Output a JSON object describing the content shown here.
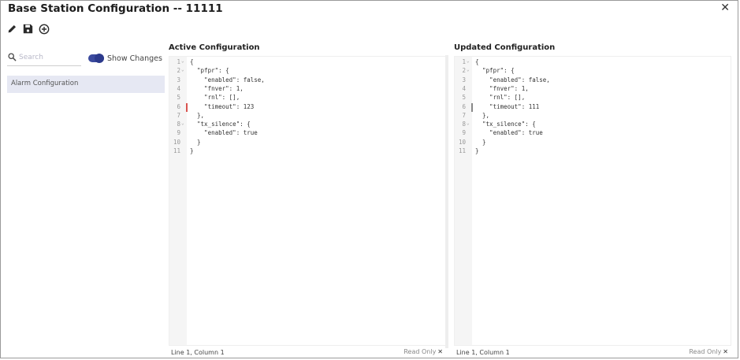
{
  "window": {
    "title": "Base Station Configuration -- 11111",
    "close_glyph": "✕"
  },
  "toolbar": {
    "icons": [
      "pencil-icon",
      "save-icon",
      "plus-circle-icon"
    ]
  },
  "sidebar": {
    "search_placeholder": "Search",
    "show_changes_label": "Show Changes",
    "show_changes_on": true,
    "items": [
      {
        "label": "Alarm Configuration"
      }
    ]
  },
  "panes": {
    "active": {
      "title": "Active Configuration",
      "lines": [
        {
          "n": "1",
          "fold": "⌄",
          "code": "{"
        },
        {
          "n": "2",
          "fold": "⌄",
          "code": "  \"pfpr\": {"
        },
        {
          "n": "3",
          "fold": "",
          "code": "    \"enabled\": false,"
        },
        {
          "n": "4",
          "fold": "",
          "code": "    \"fnver\": 1,"
        },
        {
          "n": "5",
          "fold": "",
          "code": "    \"rnl\": [],"
        },
        {
          "n": "6",
          "fold": "",
          "code": "    \"timeout\": 123"
        },
        {
          "n": "7",
          "fold": "",
          "code": "  },"
        },
        {
          "n": "8",
          "fold": "⌄",
          "code": "  \"tx_silence\": {"
        },
        {
          "n": "9",
          "fold": "",
          "code": "    \"enabled\": true"
        },
        {
          "n": "10",
          "fold": "",
          "code": "  }"
        },
        {
          "n": "11",
          "fold": "",
          "code": "}"
        }
      ],
      "status_position": "Line 1, Column 1",
      "status_mode": "Read Only"
    },
    "updated": {
      "title": "Updated Configuration",
      "lines": [
        {
          "n": "1",
          "fold": "⌄",
          "code": "{"
        },
        {
          "n": "2",
          "fold": "⌄",
          "code": "  \"pfpr\": {"
        },
        {
          "n": "3",
          "fold": "",
          "code": "    \"enabled\": false,"
        },
        {
          "n": "4",
          "fold": "",
          "code": "    \"fnver\": 1,"
        },
        {
          "n": "5",
          "fold": "",
          "code": "    \"rnl\": [],"
        },
        {
          "n": "6",
          "fold": "",
          "code": "    \"timeout\": 111"
        },
        {
          "n": "7",
          "fold": "",
          "code": "  },"
        },
        {
          "n": "8",
          "fold": "⌄",
          "code": "  \"tx_silence\": {"
        },
        {
          "n": "9",
          "fold": "",
          "code": "    \"enabled\": true"
        },
        {
          "n": "10",
          "fold": "",
          "code": "  }"
        },
        {
          "n": "11",
          "fold": "",
          "code": "}"
        }
      ],
      "status_position": "Line 1, Column 1",
      "status_mode": "Read Only"
    }
  },
  "colors": {
    "accent": "#3b4a9e",
    "selected_item_bg": "#e6e8f3",
    "change_marker": "#d9534f"
  }
}
